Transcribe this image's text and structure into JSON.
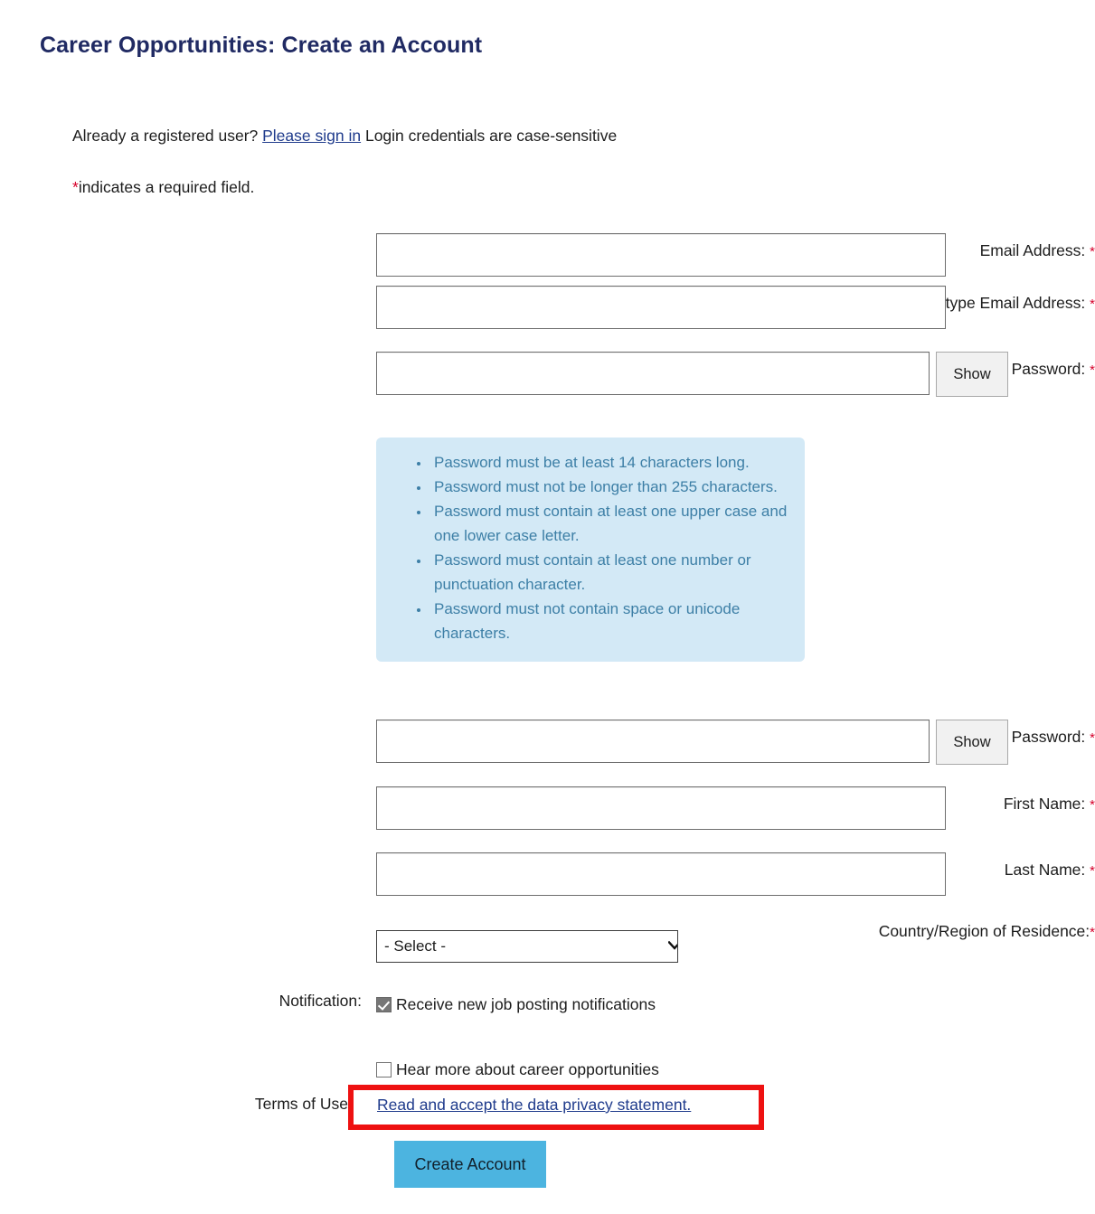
{
  "page": {
    "title": "Career Opportunities: Create an Account",
    "intro_prefix": "Already a registered user?",
    "signin_link": "Please sign in",
    "intro_suffix": "Login credentials are case-sensitive",
    "required_star": "*",
    "required_note": "indicates a required field."
  },
  "colors": {
    "title": "#202a63",
    "link": "#1f3b8c",
    "required_star": "#d6002a",
    "hint_panel_bg": "#d3e9f6",
    "hint_text": "#3d7fa6",
    "highlight_border": "#ee1111",
    "submit_bg": "#4cb4e0",
    "input_border": "#6d6d6d"
  },
  "form": {
    "fields": [
      {
        "label": "Email Address:",
        "required": "*",
        "value": "",
        "placeholder": ""
      },
      {
        "label": "Retype Email Address:",
        "required": "*",
        "value": "",
        "placeholder": ""
      },
      {
        "label": "Choose Password:",
        "required": "*",
        "value": "",
        "placeholder": "",
        "show_label": "Show"
      },
      {
        "label": "Retype Password:",
        "required": "*",
        "value": "",
        "placeholder": "",
        "show_label": "Show"
      },
      {
        "label": "First Name:",
        "required": "*",
        "value": "",
        "placeholder": ""
      },
      {
        "label": "Last Name:",
        "required": "*",
        "value": "",
        "placeholder": ""
      }
    ],
    "password_hints": [
      "Password must be at least 14 characters long.",
      "Password must not be longer than 255 characters.",
      "Password must contain at least one upper case and one lower case letter.",
      "Password must contain at least one number or punctuation character.",
      "Password must not contain space or unicode characters."
    ],
    "country": {
      "label": "Country/Region of Residence:",
      "required": "*",
      "selected": "- Select -"
    },
    "notification": {
      "label": "Notification:",
      "option_1": "Receive new job posting notifications",
      "option_1_checked": true,
      "option_2": "Hear more about career opportunities",
      "option_2_checked": false
    },
    "terms": {
      "label": "Terms of Use",
      "link": "Read and accept the data privacy statement."
    },
    "submit_label": "Create Account"
  }
}
